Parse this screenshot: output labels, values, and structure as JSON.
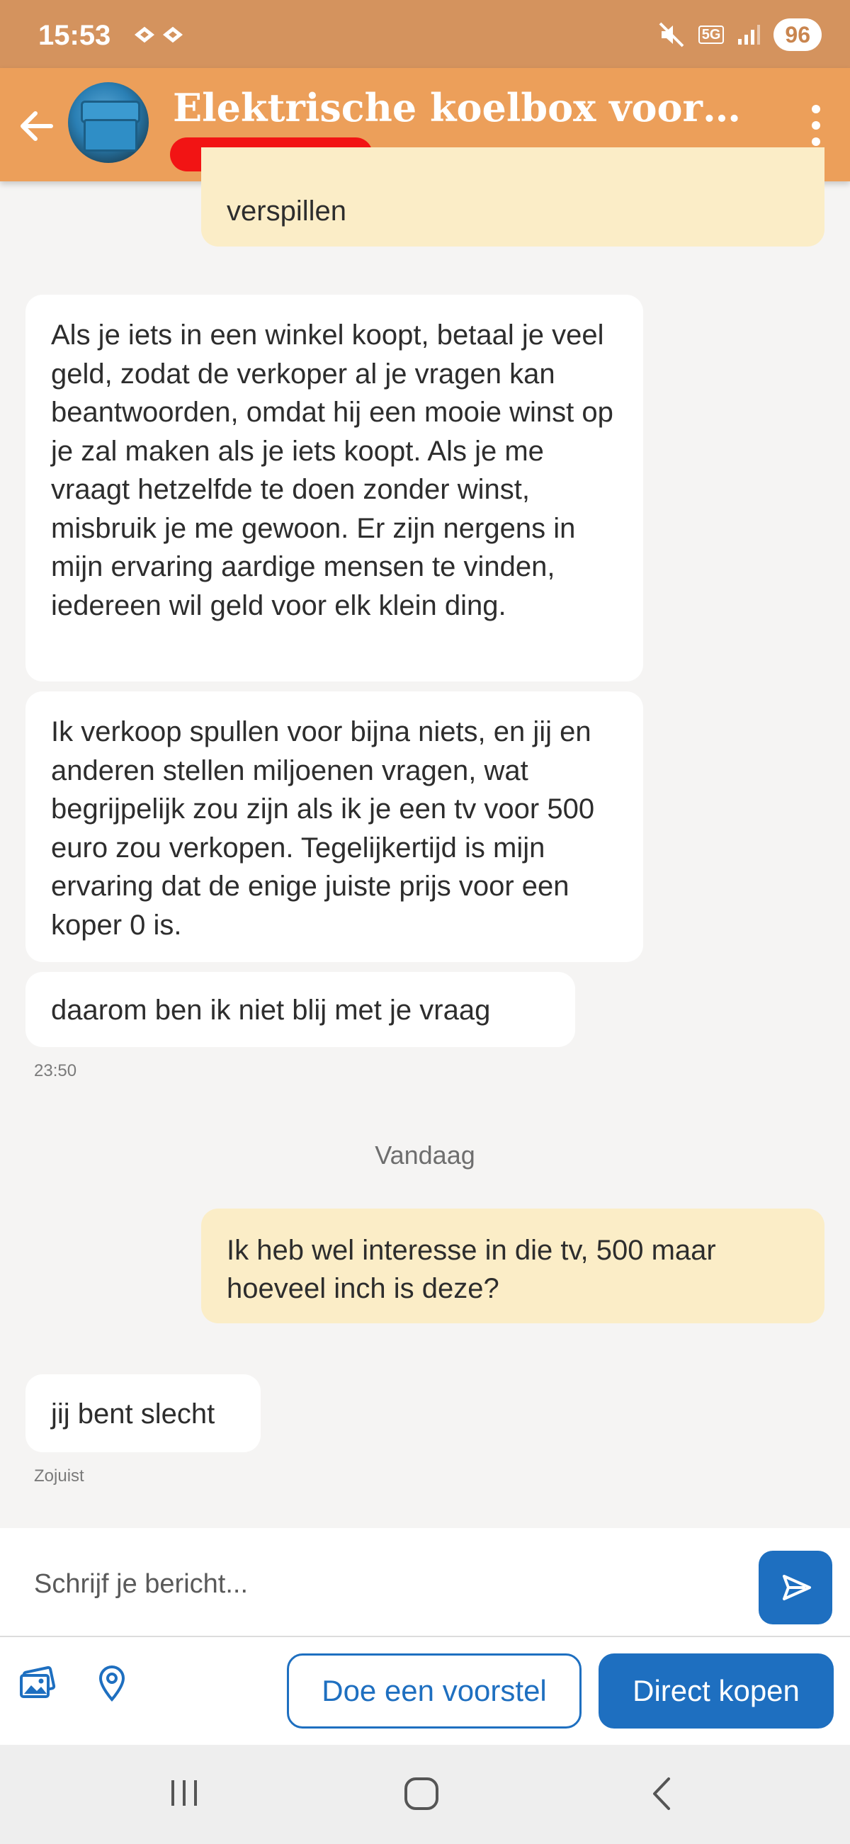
{
  "status_bar": {
    "time": "15:53",
    "network": "5G",
    "battery": "96"
  },
  "header": {
    "title": "Elektrische koelbox voor aut…",
    "accent_color": "#ec9f5a"
  },
  "messages": {
    "m0": {
      "text": "verspillen"
    },
    "m1": {
      "text": "Als je iets in een winkel koopt, betaal je veel geld, zodat de verkoper al je vragen kan beantwoorden, omdat hij een mooie winst op je zal maken als je iets koopt. Als je me vraagt hetzelfde te doen zonder winst, misbruik je me gewoon. Er zijn nergens in mijn ervaring aardige mensen te vinden, iedereen wil geld voor elk klein ding."
    },
    "m2": {
      "text": "Ik verkoop spullen voor bijna niets, en jij en anderen stellen miljoenen vragen, wat begrijpelijk zou zijn als ik je een tv voor 500 euro zou verkopen. Tegelijkertijd is mijn ervaring dat de enige juiste prijs voor een koper 0 is."
    },
    "m3": {
      "text": "daarom ben ik niet blij met je vraag",
      "time": "23:50"
    },
    "day_separator": "Vandaag",
    "m4": {
      "text": "Ik heb wel interesse in die tv, 500 maar hoeveel inch is deze?"
    },
    "m5": {
      "text": "jij bent slecht",
      "time": "Zojuist"
    }
  },
  "composer": {
    "placeholder": "Schrijf je bericht..."
  },
  "actions": {
    "offer_label": "Doe een voorstel",
    "buy_label": "Direct kopen",
    "primary_color": "#1e6fc0"
  }
}
